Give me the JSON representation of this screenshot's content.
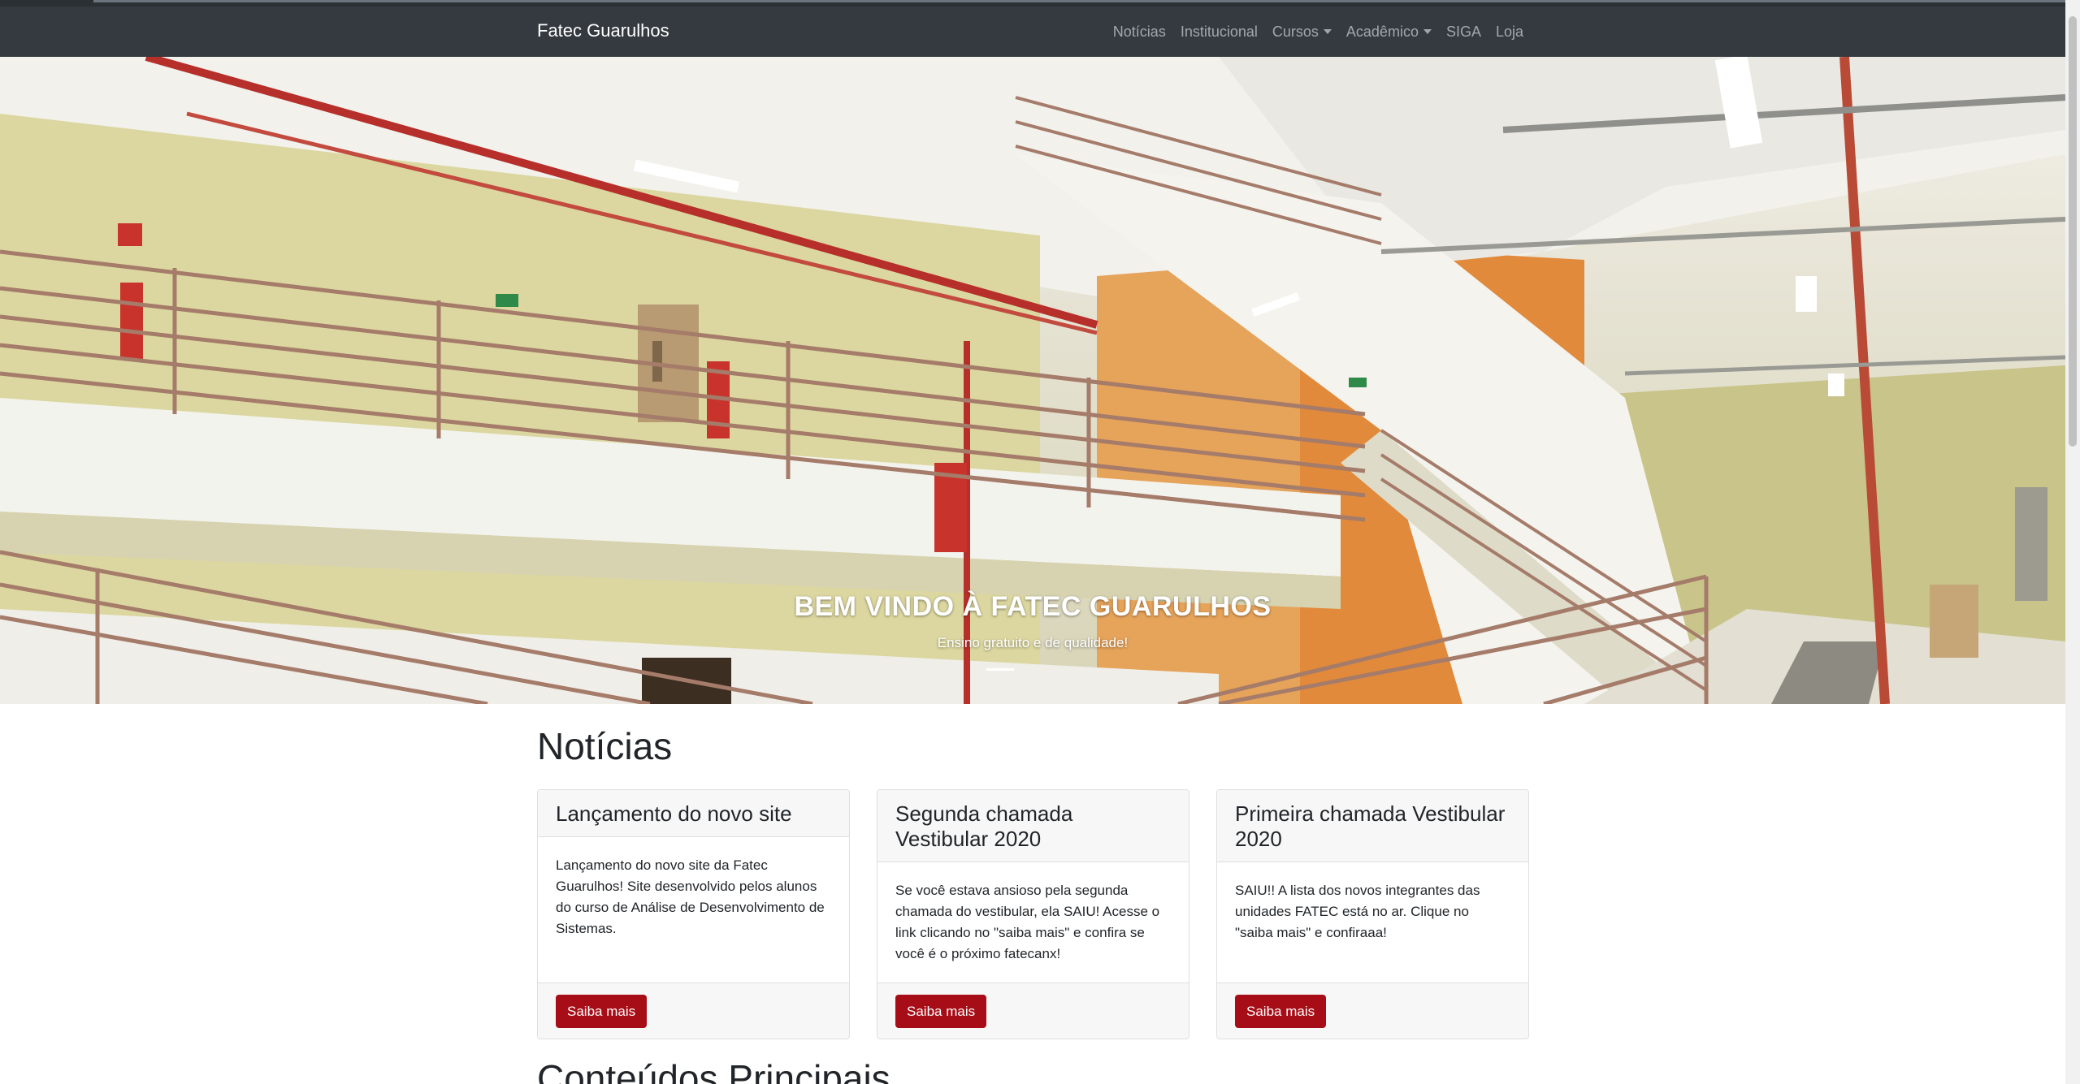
{
  "navbar": {
    "brand": "Fatec Guarulhos",
    "items": [
      {
        "label": "Notícias",
        "dropdown": false
      },
      {
        "label": "Institucional",
        "dropdown": false
      },
      {
        "label": "Cursos",
        "dropdown": true
      },
      {
        "label": "Acadêmico",
        "dropdown": true
      },
      {
        "label": "SIGA",
        "dropdown": false
      },
      {
        "label": "Loja",
        "dropdown": false
      }
    ]
  },
  "hero": {
    "title": "BEM VINDO À FATEC GUARULHOS",
    "subtitle": "Ensino gratuito e de qualidade!"
  },
  "news": {
    "title": "Notícias",
    "cards": [
      {
        "title": "Lançamento do novo site",
        "text": "Lançamento do novo site da Fatec Guarulhos! Site desenvolvido pelos alunos do curso de Análise de Desenvolvimento de Sistemas.",
        "button": "Saiba mais"
      },
      {
        "title": "Segunda chamada Vestibular 2020",
        "text": "Se você estava ansioso pela segunda chamada do vestibular, ela SAIU! Acesse o link clicando no \"saiba mais\" e confira se você é o próximo fatecanx!",
        "button": "Saiba mais"
      },
      {
        "title": "Primeira chamada Vestibular 2020",
        "text": "SAIU!! A lista dos novos integrantes das unidades FATEC está no ar. Clique no \"saiba mais\" e confiraaa!",
        "button": "Saiba mais"
      }
    ]
  },
  "content": {
    "title": "Conteúdos Principais"
  },
  "colors": {
    "navbar": "#343a40",
    "accent": "#a70d16",
    "wall_yellow": "#d9d49a",
    "wall_orange": "#e08a3a"
  }
}
